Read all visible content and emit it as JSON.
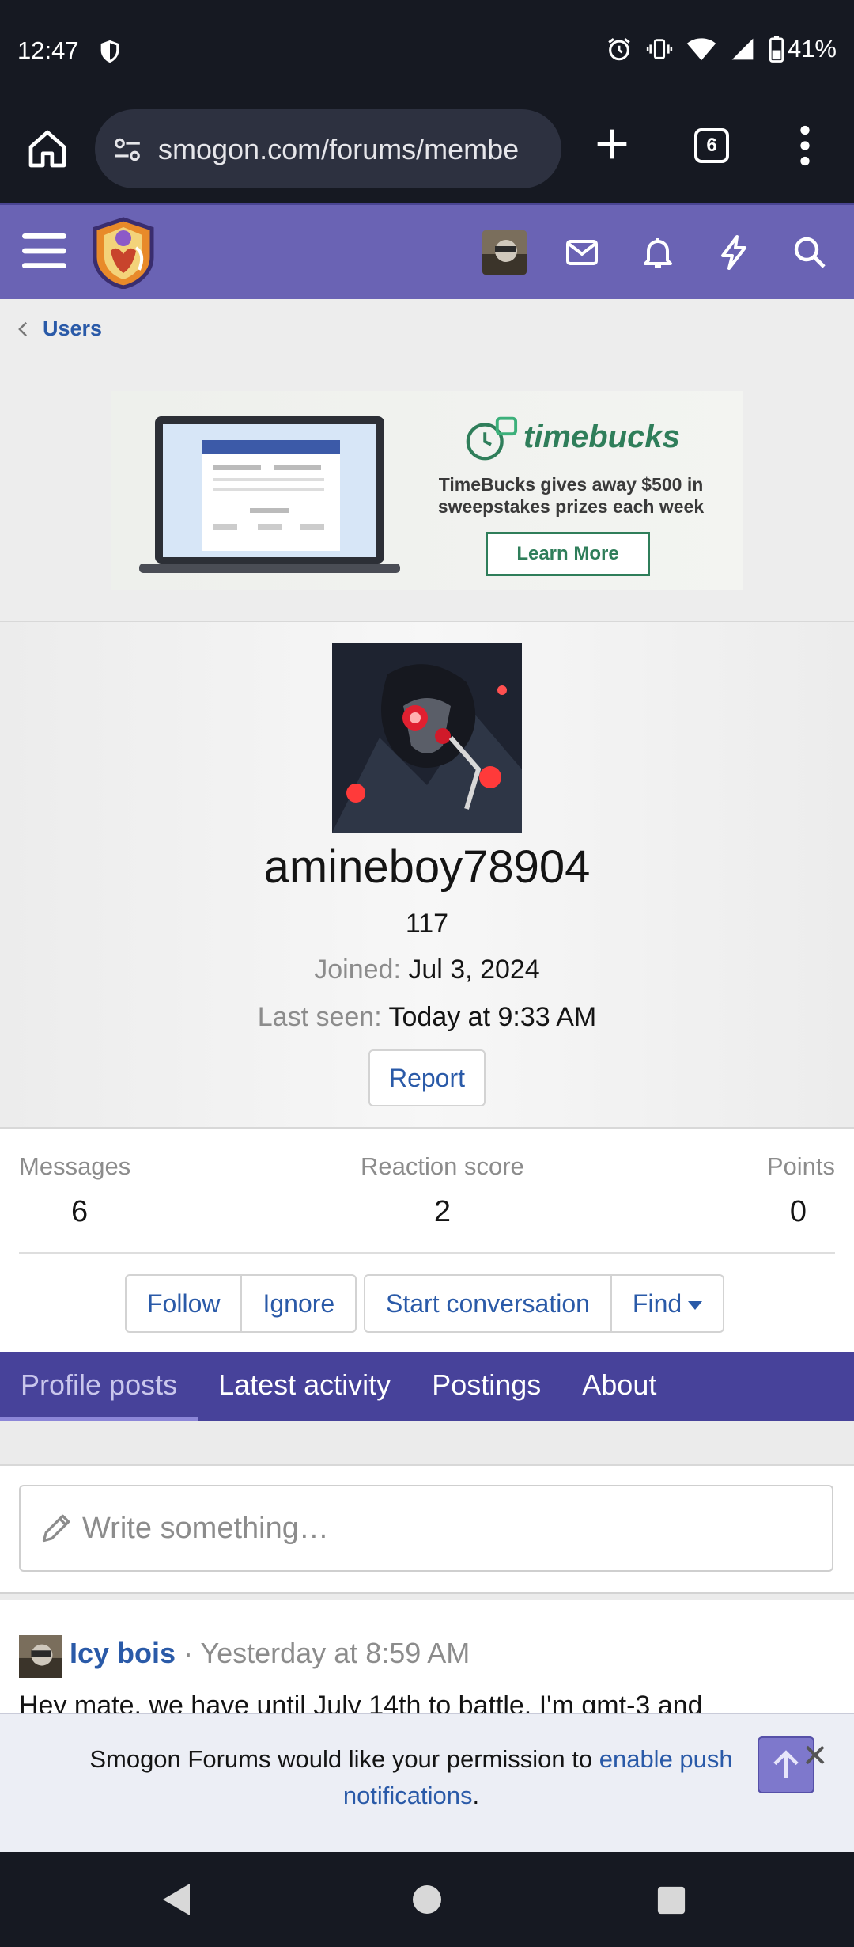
{
  "status_bar": {
    "time": "12:47",
    "battery": "41%"
  },
  "browser": {
    "url": "smogon.com/forums/membe",
    "tab_count": "6"
  },
  "breadcrumb": {
    "label": "Users"
  },
  "ad": {
    "brand": "timebucks",
    "copy": "TimeBucks gives away $500 in sweepstakes prizes each week",
    "cta": "Learn More"
  },
  "profile": {
    "username": "amineboy78904",
    "user_title": "117",
    "joined_label": "Joined:",
    "joined_value": "Jul 3, 2024",
    "last_seen_label": "Last seen:",
    "last_seen_value": "Today at 9:33 AM",
    "report_label": "Report"
  },
  "stats": {
    "messages_label": "Messages",
    "messages_value": "6",
    "reaction_label": "Reaction score",
    "reaction_value": "2",
    "points_label": "Points",
    "points_value": "0"
  },
  "actions": {
    "follow": "Follow",
    "ignore": "Ignore",
    "start_conversation": "Start conversation",
    "find": "Find"
  },
  "tabs": [
    {
      "label": "Profile posts"
    },
    {
      "label": "Latest activity"
    },
    {
      "label": "Postings"
    },
    {
      "label": "About"
    }
  ],
  "compose": {
    "placeholder": "Write something…"
  },
  "post": {
    "author": "Icy bois",
    "separator": " · ",
    "time": "Yesterday at 8:59 AM",
    "text": "Hey mate, we have until July 14th to battle. I'm gmt-3 and"
  },
  "push": {
    "text": "Smogon Forums would like your permission to",
    "link": "enable push notifications",
    "end": "."
  },
  "colors": {
    "header": "#6a63b4",
    "tabs": "#47429a",
    "link": "#2a5aa8"
  }
}
